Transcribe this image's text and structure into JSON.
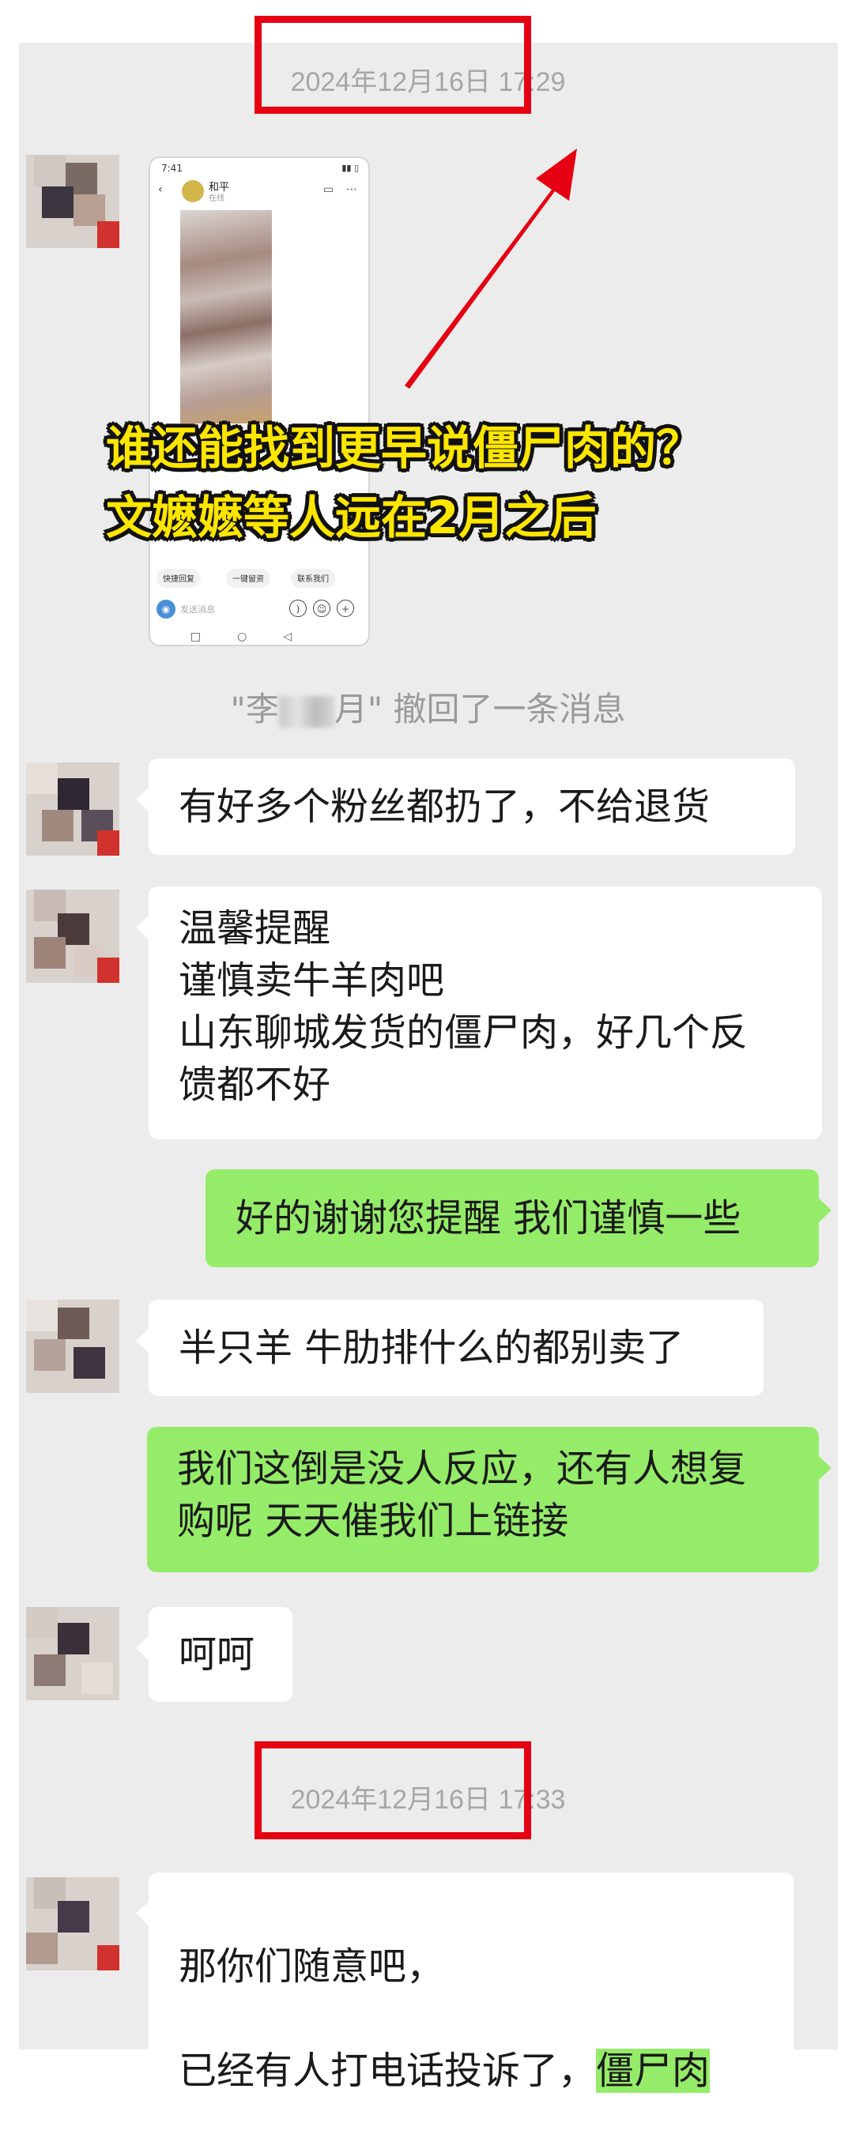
{
  "timestamps": {
    "first": "2024年12月16日 17:29",
    "second": "2024年12月16日 17:33"
  },
  "phone_screenshot": {
    "time": "7:41",
    "contact_name": "和平",
    "contact_status": "在线",
    "quick_actions": [
      "快捷回复",
      "一键留资",
      "联系我们"
    ],
    "input_placeholder": "发送消息",
    "nav_glyphs": "□○◁"
  },
  "overlay_caption": {
    "line1": "谁还能找到更早说僵尸肉的？",
    "line2": "文嬷嬷等人远在2月之后"
  },
  "recall_notice": {
    "prefix": "\"李",
    "suffix": "月\" 撤回了一条消息"
  },
  "messages": [
    {
      "side": "left",
      "text": "有好多个粉丝都扔了，不给退货"
    },
    {
      "side": "left",
      "text": "温馨提醒\n谨慎卖牛羊肉吧\n山东聊城发货的僵尸肉，好几个反\n馈都不好"
    },
    {
      "side": "right",
      "text": "好的谢谢您提醒 我们谨慎一些"
    },
    {
      "side": "left",
      "text": "半只羊 牛肋排什么的都别卖了"
    },
    {
      "side": "right",
      "text": "我们这倒是没人反应，还有人想复\n购呢 天天催我们上链接"
    },
    {
      "side": "left",
      "text": "呵呵"
    },
    {
      "side": "left",
      "text_line1": "那你们随意吧，",
      "text_line2": "已经有人打电话投诉了，",
      "highlight": "僵尸肉"
    }
  ],
  "colors": {
    "chat_background": "#ececec",
    "bubble_self": "#95ec69",
    "bubble_other": "#ffffff",
    "annotation_red": "#e50012",
    "caption_yellow": "#ffe600"
  }
}
